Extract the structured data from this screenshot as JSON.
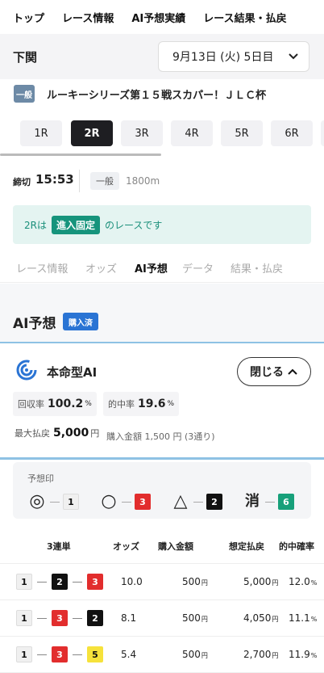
{
  "topnav": [
    "トップ",
    "レース情報",
    "AI予想実績",
    "レース結果・払戻"
  ],
  "venue": {
    "name": "下関",
    "date_select": "9月13日 (火) 5日目"
  },
  "race": {
    "grade": "一般",
    "title": "ルーキーシリーズ第１５戦スカパー！ＪＬＣ杯"
  },
  "race_tabs": [
    "1R",
    "2R",
    "3R",
    "4R",
    "5R",
    "6R"
  ],
  "active_race_tab": "2R",
  "close": {
    "label": "締切",
    "time": "15:53",
    "grade": "一般",
    "distance": "1800m"
  },
  "info": {
    "prefix": "2Rは",
    "badge": "進入固定",
    "suffix": "のレースです"
  },
  "sub_tabs": [
    "レース情報",
    "オッズ",
    "AI予想",
    "データ",
    "結果・払戻"
  ],
  "active_sub_tab": "AI予想",
  "ai": {
    "heading": "AI予想",
    "status_badge": "購入済",
    "model_name": "本命型AI",
    "close_button": "閉じる",
    "recovery_label": "回収率",
    "recovery_value": "100.2",
    "recovery_unit": "%",
    "hit_label": "的中率",
    "hit_value": "19.6",
    "hit_unit": "%",
    "max_label": "最大払戻",
    "max_value": "5,000",
    "max_unit": "円",
    "buy_text": "購入金額 1,500 円 (3通り)"
  },
  "marks": {
    "title": "予想印",
    "items": [
      {
        "symbol": "◎",
        "number": "1"
      },
      {
        "symbol": "○",
        "number": "3"
      },
      {
        "symbol": "△",
        "number": "2"
      },
      {
        "symbol": "消",
        "number": "6"
      }
    ]
  },
  "table": {
    "headers": [
      "3連単",
      "オッズ",
      "購入金額",
      "想定払戻",
      "的中確率"
    ],
    "rows": [
      {
        "combo": [
          "1",
          "2",
          "3"
        ],
        "odds": "10.0",
        "amount": "500",
        "payout": "5,000",
        "rate": "12.0"
      },
      {
        "combo": [
          "1",
          "3",
          "2"
        ],
        "odds": "8.1",
        "amount": "500",
        "payout": "4,050",
        "rate": "11.1"
      },
      {
        "combo": [
          "1",
          "3",
          "5"
        ],
        "odds": "5.4",
        "amount": "500",
        "payout": "2,700",
        "rate": "11.9"
      }
    ],
    "yen_unit": "円",
    "pct_unit": "%"
  }
}
